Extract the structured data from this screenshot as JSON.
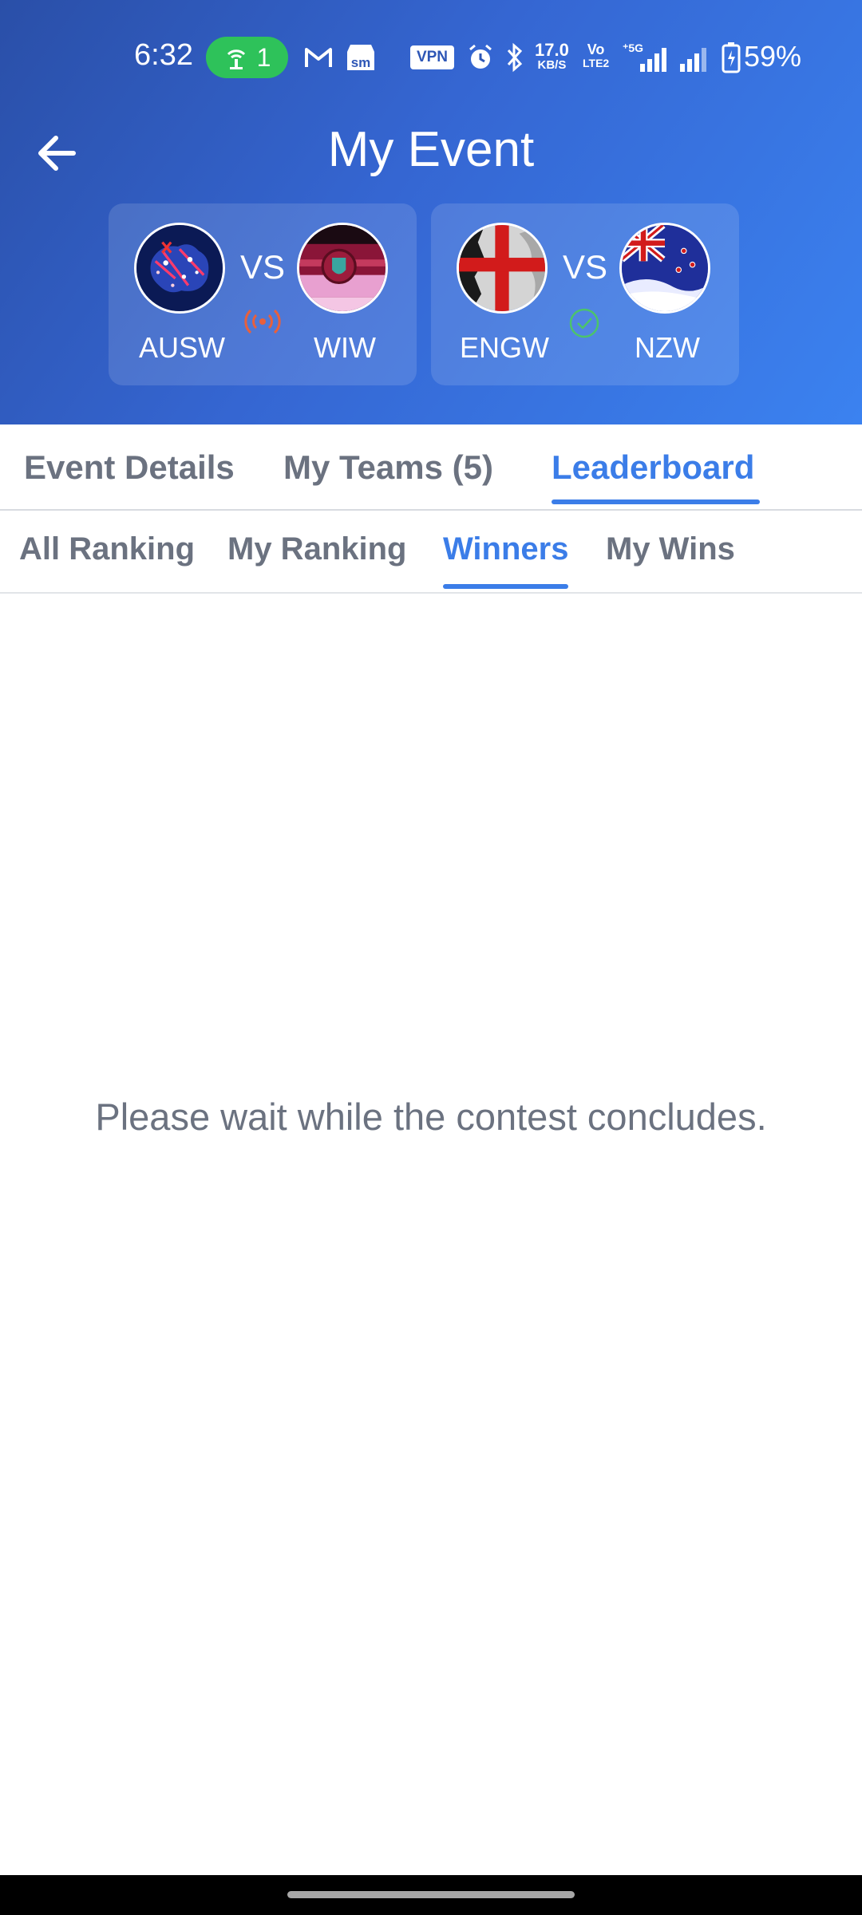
{
  "status_bar": {
    "time": "6:32",
    "hotspot_count": "1",
    "vpn": "VPN",
    "speed_value": "17.0",
    "speed_unit": "KB/S",
    "volte_top": "Vo",
    "volte_bottom": "LTE2",
    "network": "5G",
    "battery": "59%"
  },
  "header": {
    "title": "My Event",
    "background_start": "#2a4fa8",
    "background_end": "#3b82f0"
  },
  "matches": [
    {
      "team1": "AUSW",
      "vs": "VS",
      "team2": "WIW",
      "status_icon": "live-broadcast-icon",
      "status_color": "#e8603c"
    },
    {
      "team1": "ENGW",
      "vs": "VS",
      "team2": "NZW",
      "status_icon": "check-circle-icon",
      "status_color": "#4cc46a"
    }
  ],
  "main_tabs": [
    {
      "label": "Event Details",
      "active": false
    },
    {
      "label": "My Teams (5)",
      "active": false
    },
    {
      "label": "Leaderboard",
      "active": true
    }
  ],
  "sub_tabs": [
    {
      "label": "All Ranking",
      "active": false
    },
    {
      "label": "My Ranking",
      "active": false
    },
    {
      "label": "Winners",
      "active": true
    },
    {
      "label": "My Wins",
      "active": false
    }
  ],
  "content": {
    "empty_message": "Please wait while the contest concludes."
  },
  "accent_color": "#3b7de8"
}
